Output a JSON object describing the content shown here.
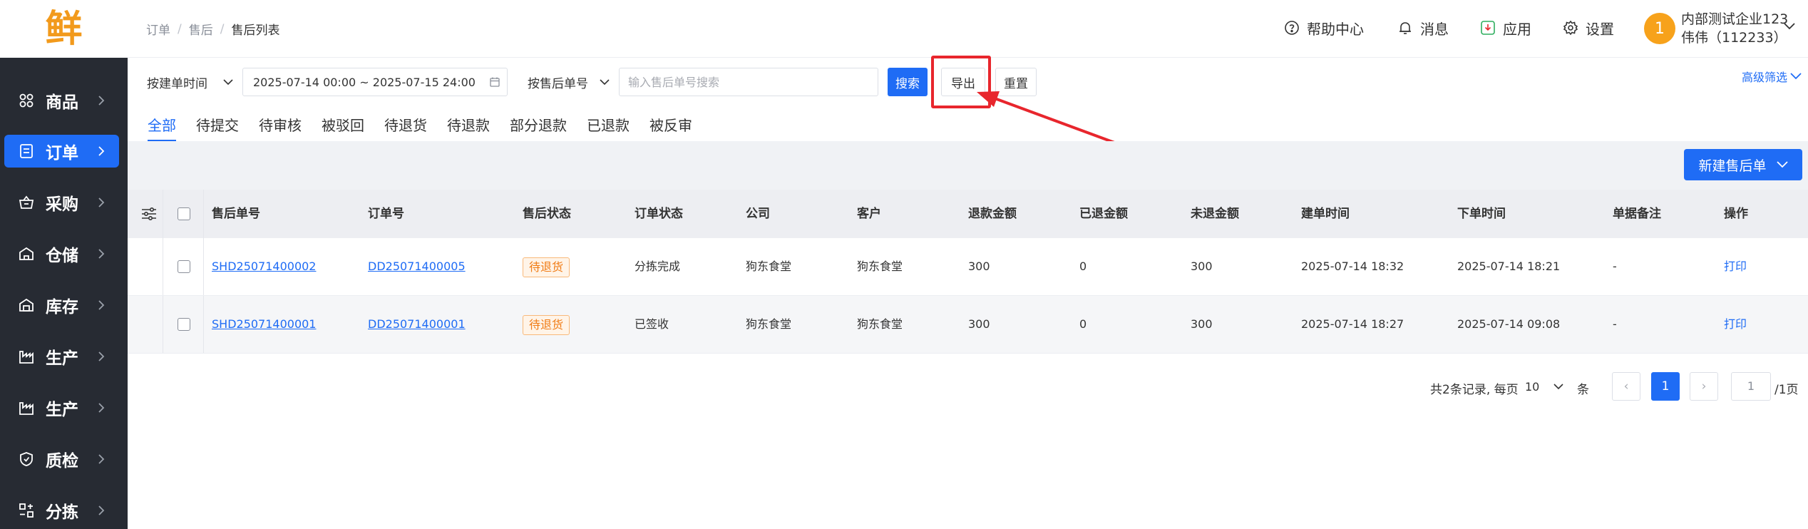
{
  "logo": {
    "glyph": "鲜"
  },
  "sidebar": {
    "items": [
      {
        "label": "商品",
        "icon": "grid-icon",
        "active": false
      },
      {
        "label": "订单",
        "icon": "receipt-icon",
        "active": true
      },
      {
        "label": "采购",
        "icon": "basket-icon",
        "active": false
      },
      {
        "label": "仓储",
        "icon": "warehouse-icon",
        "active": false
      },
      {
        "label": "库存",
        "icon": "storage-icon",
        "active": false
      },
      {
        "label": "生产",
        "icon": "factory-icon",
        "active": false
      },
      {
        "label": "生产",
        "icon": "factory-icon",
        "active": false
      },
      {
        "label": "质检",
        "icon": "shield-icon",
        "active": false
      },
      {
        "label": "分拣",
        "icon": "sort-icon",
        "active": false
      }
    ]
  },
  "header": {
    "breadcrumb": [
      "订单",
      "售后",
      "售后列表"
    ],
    "help": "帮助中心",
    "messages": "消息",
    "apps": "应用",
    "settings": "设置",
    "avatar_text": "1",
    "company": "内部测试企业123",
    "user": "伟伟（112233）"
  },
  "filters": {
    "time_type": "按建单时间",
    "date_range": "2025-07-14 00:00 ~ 2025-07-15 24:00",
    "search_type": "按售后单号",
    "search_placeholder": "输入售后单号搜索",
    "search_value": "",
    "search_btn": "搜索",
    "export_btn": "导出",
    "reset_btn": "重置",
    "advanced": "高级筛选"
  },
  "tabs": [
    "全部",
    "待提交",
    "待审核",
    "被驳回",
    "待退货",
    "待退款",
    "部分退款",
    "已退款",
    "被反审"
  ],
  "active_tab": 0,
  "new_button": "新建售后单",
  "table": {
    "columns": [
      "售后单号",
      "订单号",
      "售后状态",
      "订单状态",
      "公司",
      "客户",
      "退款金额",
      "已退金额",
      "未退金额",
      "建单时间",
      "下单时间",
      "单据备注",
      "操作"
    ],
    "rows": [
      {
        "aftersale_no": "SHD25071400002",
        "order_no": "DD25071400005",
        "aftersale_status": "待退货",
        "order_status": "分拣完成",
        "company": "狗东食堂",
        "customer": "狗东食堂",
        "refund_amount": "300",
        "refunded": "0",
        "unrefunded": "300",
        "created_at": "2025-07-14 18:32",
        "ordered_at": "2025-07-14 18:21",
        "remark": "-",
        "action": "打印"
      },
      {
        "aftersale_no": "SHD25071400001",
        "order_no": "DD25071400001",
        "aftersale_status": "待退货",
        "order_status": "已签收",
        "company": "狗东食堂",
        "customer": "狗东食堂",
        "refund_amount": "300",
        "refunded": "0",
        "unrefunded": "300",
        "created_at": "2025-07-14 18:27",
        "ordered_at": "2025-07-14 09:08",
        "remark": "-",
        "action": "打印"
      }
    ]
  },
  "pagination": {
    "summary": "共2条记录, 每页",
    "page_size": "10",
    "unit": "条",
    "prev": "‹",
    "current": "1",
    "next": "›",
    "jump_value": "1",
    "total_pages": "/1页"
  },
  "colors": {
    "primary": "#1f6cf5",
    "sidebar": "#272b33",
    "annotation": "#e8262d",
    "logo": "#f29a1c",
    "status_tag": "#f07b14"
  }
}
